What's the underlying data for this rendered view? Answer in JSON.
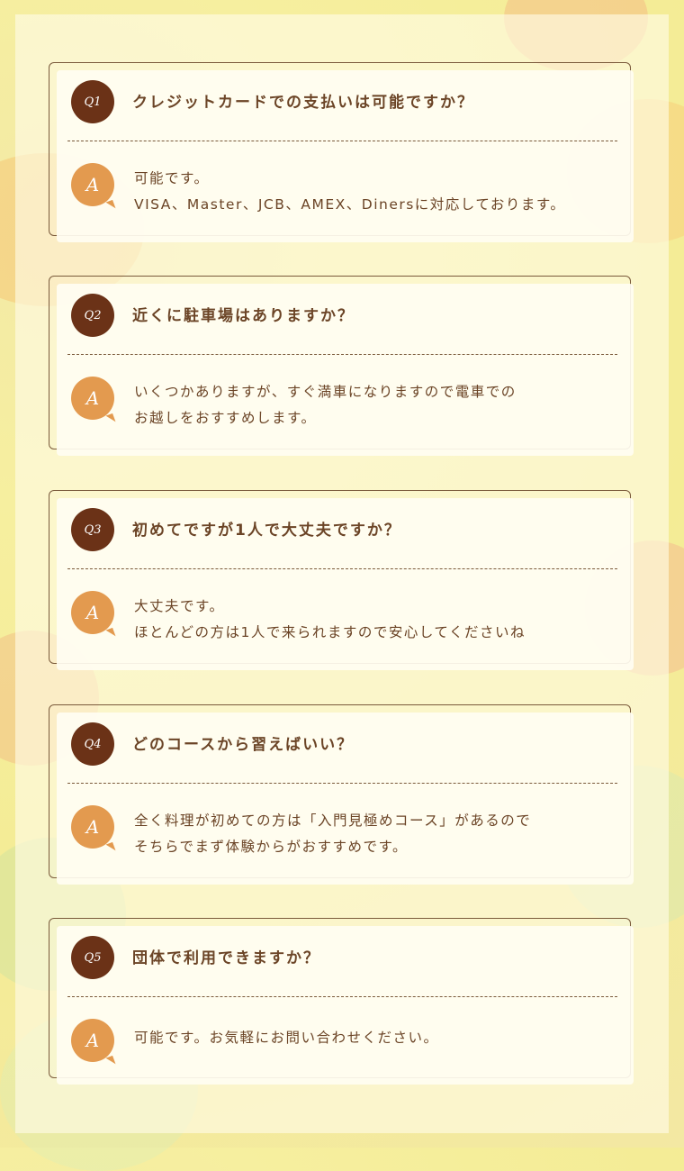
{
  "faq": [
    {
      "q_badge": "Q1",
      "question": "クレジットカードでの支払いは可能ですか？",
      "a_badge": "A",
      "answer_lines": [
        "可能です。",
        "VISA、Master、JCB、AMEX、Dinersに対応しております。"
      ]
    },
    {
      "q_badge": "Q2",
      "question": "近くに駐車場はありますか？",
      "a_badge": "A",
      "answer_lines": [
        "いくつかありますが、すぐ満車になりますので電車での",
        "お越しをおすすめします。"
      ]
    },
    {
      "q_badge": "Q3",
      "question": "初めてですが1人で大丈夫ですか？",
      "a_badge": "A",
      "answer_lines": [
        "大丈夫です。",
        "ほとんどの方は1人で来られますので安心してくださいね"
      ]
    },
    {
      "q_badge": "Q4",
      "question": "どのコースから習えばいい？",
      "a_badge": "A",
      "answer_lines": [
        "全く料理が初めての方は「入門見極めコース」があるので",
        "そちらでまず体験からがおすすめです。"
      ]
    },
    {
      "q_badge": "Q5",
      "question": "団体で利用できますか？",
      "a_badge": "A",
      "answer_lines": [
        "可能です。お気軽にお問い合わせください。"
      ]
    }
  ],
  "colors": {
    "question_badge": "#6b3217",
    "answer_badge": "#e39a4f",
    "text": "#6b4426",
    "border": "#7a5a3b"
  }
}
